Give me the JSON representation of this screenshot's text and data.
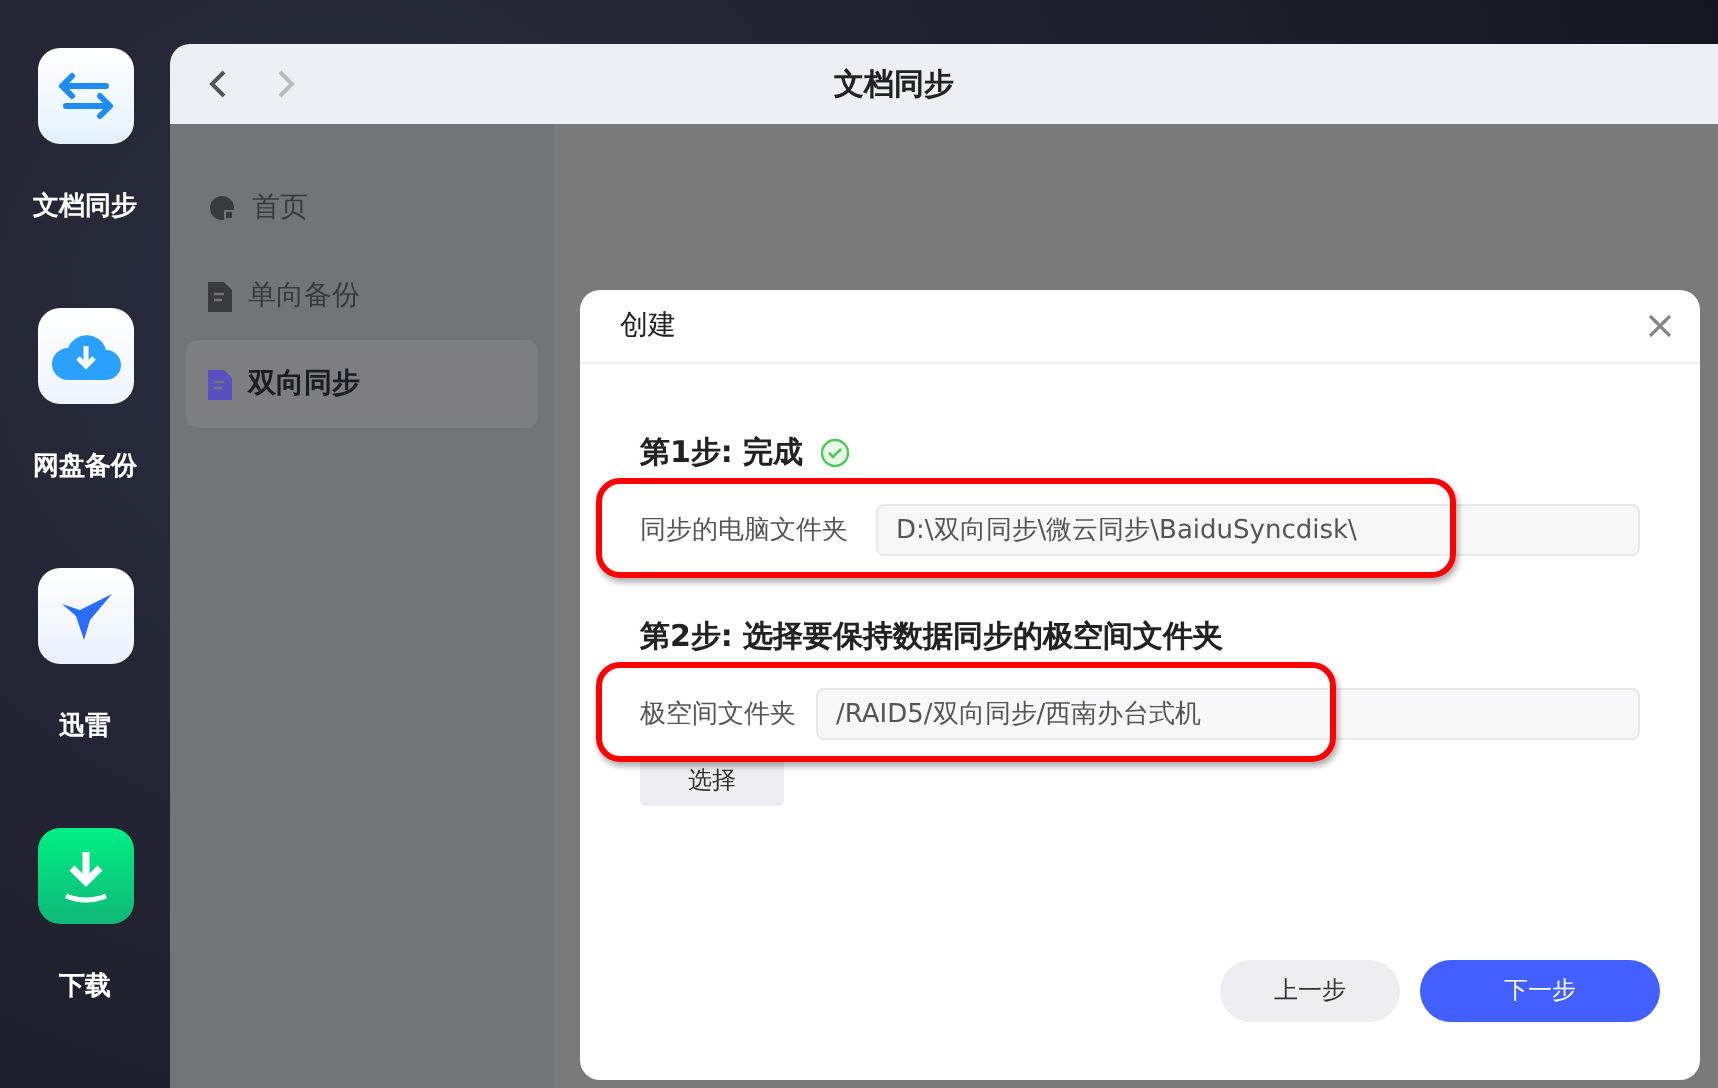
{
  "dock": [
    {
      "label": "文档同步",
      "kind": "sync"
    },
    {
      "label": "网盘备份",
      "kind": "cloud"
    },
    {
      "label": "迅雷",
      "kind": "bird"
    },
    {
      "label": "下载",
      "kind": "download"
    }
  ],
  "window": {
    "title": "文档同步"
  },
  "nav": [
    {
      "label": "首页",
      "kind": "home",
      "selected": false
    },
    {
      "label": "单向备份",
      "kind": "backup",
      "selected": false
    },
    {
      "label": "双向同步",
      "kind": "sync",
      "selected": true
    }
  ],
  "dialog": {
    "title": "创建",
    "steps": [
      {
        "title": "第1步: 完成",
        "done": true,
        "label": "同步的电脑文件夹",
        "value": "D:\\双向同步\\微云同步\\BaiduSyncdisk\\"
      },
      {
        "title": "第2步: 选择要保持数据同步的极空间文件夹",
        "done": false,
        "label": "极空间文件夹",
        "value": "/RAID5/双向同步/西南办台式机"
      }
    ],
    "select_button": "选择",
    "prev_button": "上一步",
    "next_button": "下一步"
  }
}
